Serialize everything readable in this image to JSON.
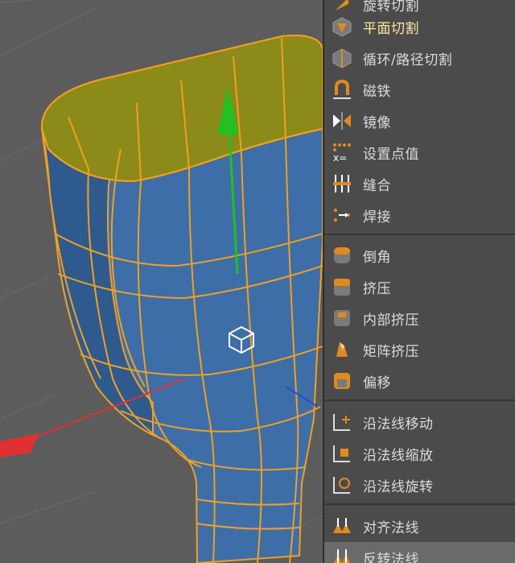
{
  "menu": {
    "items": [
      {
        "label": "旋转切割",
        "icon": "knife-rotate-icon"
      },
      {
        "label": "平面切割",
        "icon": "plane-cut-icon",
        "active": true
      },
      {
        "label": "循环/路径切割",
        "icon": "loop-cut-icon"
      },
      {
        "label": "磁铁",
        "icon": "magnet-icon"
      },
      {
        "label": "镜像",
        "icon": "mirror-icon"
      },
      {
        "label": "设置点值",
        "icon": "set-point-value-icon"
      },
      {
        "label": "缝合",
        "icon": "stitch-icon"
      },
      {
        "label": "焊接",
        "icon": "weld-icon"
      },
      {
        "label": "倒角",
        "icon": "bevel-icon"
      },
      {
        "label": "挤压",
        "icon": "extrude-icon"
      },
      {
        "label": "内部挤压",
        "icon": "inner-extrude-icon"
      },
      {
        "label": "矩阵挤压",
        "icon": "matrix-extrude-icon"
      },
      {
        "label": "偏移",
        "icon": "offset-icon"
      },
      {
        "label": "沿法线移动",
        "icon": "normal-move-icon"
      },
      {
        "label": "沿法线缩放",
        "icon": "normal-scale-icon"
      },
      {
        "label": "沿法线旋转",
        "icon": "normal-rotate-icon"
      },
      {
        "label": "对齐法线",
        "icon": "align-normals-icon"
      },
      {
        "label": "反转法线",
        "icon": "reverse-normals-icon",
        "hover": true
      }
    ]
  },
  "colors": {
    "mesh_fill": "#3d6ea8",
    "mesh_fill_dark": "#2f5a8e",
    "selected_face": "#8c8a18",
    "wireframe": "#f0a020",
    "gizmo_y": "#22c022",
    "gizmo_x": "#e03030",
    "gizmo_z": "#2a4ad8",
    "label_text": "#dcdcdc",
    "label_active": "#ffe8a0"
  },
  "viewport": {
    "object": "cup-mesh",
    "active_axis": "y-axis"
  }
}
